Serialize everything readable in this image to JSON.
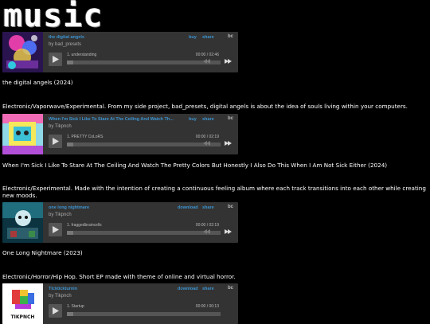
{
  "site": {
    "logo": "music"
  },
  "common": {
    "buy": "buy",
    "share": "share",
    "download": "download",
    "bc": "bc"
  },
  "players": [
    {
      "title": "the digital angels",
      "artist": "by bad_presets",
      "track": "1.  understanding",
      "time": "00:00 / 02:46",
      "action": "buy"
    },
    {
      "title": "When I'm Sick I Like To Stare At The Ceiling And Watch Th...",
      "artist": "by Tikpnch",
      "track": "1.  PRETTY CoLoRS",
      "time": "00:00 / 02:19",
      "action": "buy"
    },
    {
      "title": "one long nightmare",
      "artist": "by Tikpnch",
      "track": "1.  fraggedbraincells",
      "time": "00:00 / 02:19",
      "action": "download"
    },
    {
      "title": "TIcktickturnin",
      "artist": "by Tikpnch",
      "track": "1.  Startup",
      "time": "00:00 / 00:13",
      "action": "download"
    }
  ],
  "albums": [
    {
      "caption": "the digital angels (2024)",
      "description": "Electronic/Vaporwave/Experimental. From my side project, bad_presets, digital angels is about the idea of souls living within your computers."
    },
    {
      "caption": "When I'm Sick I Like To Stare At The Ceiling And Watch The Pretty Colors But Honestly I Also Do This When I Am Not Sick Either (2024)",
      "description": "Electronic/Experimental. Made with the intention of creating a continuous feeling album where each track transitions into each other while creating new moods."
    },
    {
      "caption": "One Long Nightmare (2023)",
      "description": "Electronic/Horror/Hip Hop. Short EP made with theme of online and virtual horror."
    }
  ],
  "art4_label": "TIKPNCH"
}
